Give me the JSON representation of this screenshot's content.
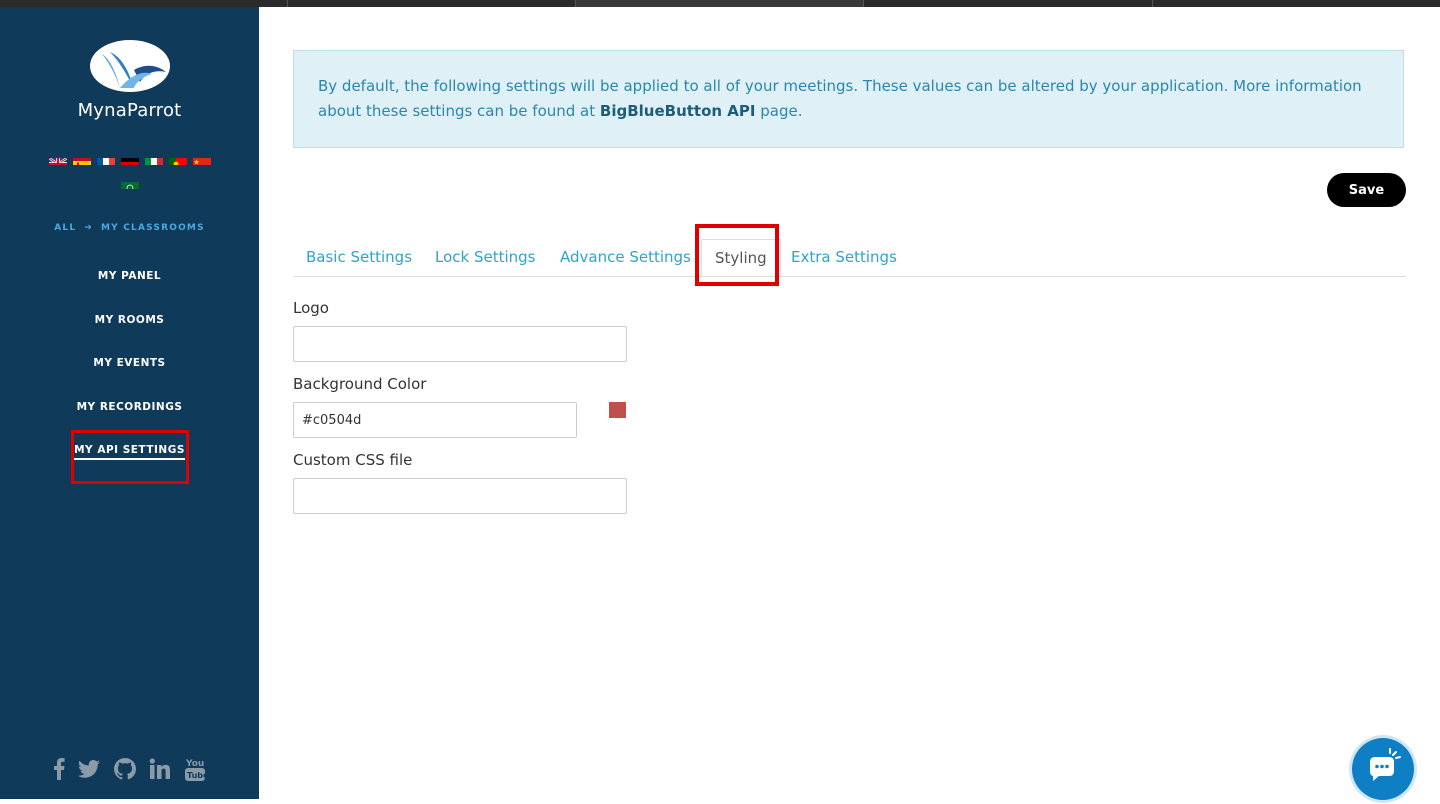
{
  "brand": {
    "name": "MynaParrot"
  },
  "languages": [
    {
      "icon": "flag-uk-icon"
    },
    {
      "icon": "flag-spain-icon"
    },
    {
      "icon": "flag-france-icon"
    },
    {
      "icon": "flag-germany-icon"
    },
    {
      "icon": "flag-italy-icon"
    },
    {
      "icon": "flag-portugal-icon"
    },
    {
      "icon": "flag-china-icon"
    },
    {
      "icon": "flag-saudi-arabia-icon"
    }
  ],
  "breadcrumb": {
    "all": "ALL",
    "arrow": "➔",
    "current": "MY CLASSROOMS"
  },
  "nav": {
    "items": [
      {
        "label": "MY PANEL"
      },
      {
        "label": "MY ROOMS"
      },
      {
        "label": "MY EVENTS"
      },
      {
        "label": "MY RECORDINGS"
      },
      {
        "label": "MY API SETTINGS"
      }
    ],
    "active_index": 4
  },
  "info": {
    "text_before": "By default, the following settings will be applied to all of your meetings. These values can be altered by your application. More information about these settings can be found at ",
    "link": "BigBlueButton API",
    "text_after": " page."
  },
  "actions": {
    "save_label": "Save"
  },
  "tabs": {
    "items": [
      {
        "label": "Basic Settings"
      },
      {
        "label": "Lock Settings"
      },
      {
        "label": "Advance Settings"
      },
      {
        "label": "Styling"
      },
      {
        "label": "Extra Settings"
      }
    ],
    "active_index": 3
  },
  "form": {
    "logo": {
      "label": "Logo",
      "value": ""
    },
    "background_color": {
      "label": "Background Color",
      "value": "#c0504d",
      "swatch": "#c0504d"
    },
    "custom_css": {
      "label": "Custom CSS file",
      "value": ""
    }
  },
  "social": [
    "facebook-icon",
    "twitter-icon",
    "github-icon",
    "linkedin-icon",
    "youtube-icon"
  ],
  "colors": {
    "sidebar": "#0f3a5a",
    "accent": "#31a3c9",
    "highlight": "#e00000"
  }
}
